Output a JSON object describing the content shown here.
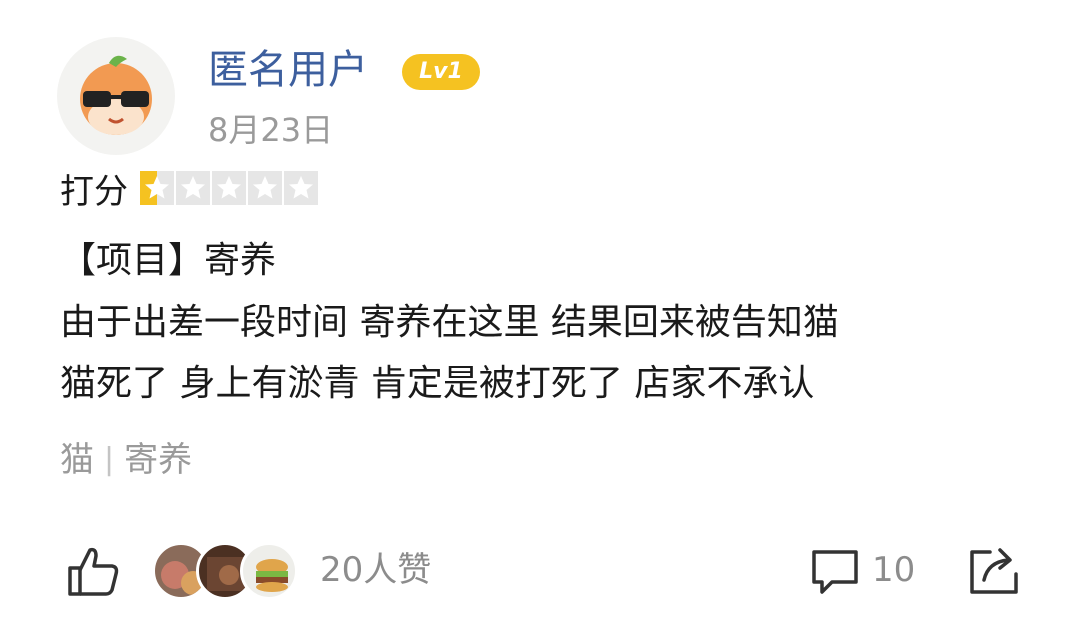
{
  "post": {
    "username": "匿名用户",
    "level": "Lv1",
    "date": "8月23日",
    "rating_label": "打分",
    "rating_value": 1,
    "rating_max": 5,
    "lines": [
      "【项目】寄养",
      "由于出差一段时间 寄养在这里 结果回来被告知猫",
      "猫死了 身上有淤青 肯定是被打死了 店家不承认"
    ],
    "tags": [
      "猫",
      "寄养"
    ],
    "tag_separator": "|"
  },
  "actions": {
    "like_count_label": "20人赞",
    "comment_count": "10",
    "like_icon": "thumbs-up-icon",
    "comment_icon": "comment-icon",
    "share_icon": "share-icon"
  },
  "colors": {
    "username": "#3d5f9e",
    "level_badge": "#f5c221",
    "star_filled": "#f5c221",
    "star_empty": "#e6e6e6",
    "muted_text": "#9a9a9a"
  }
}
